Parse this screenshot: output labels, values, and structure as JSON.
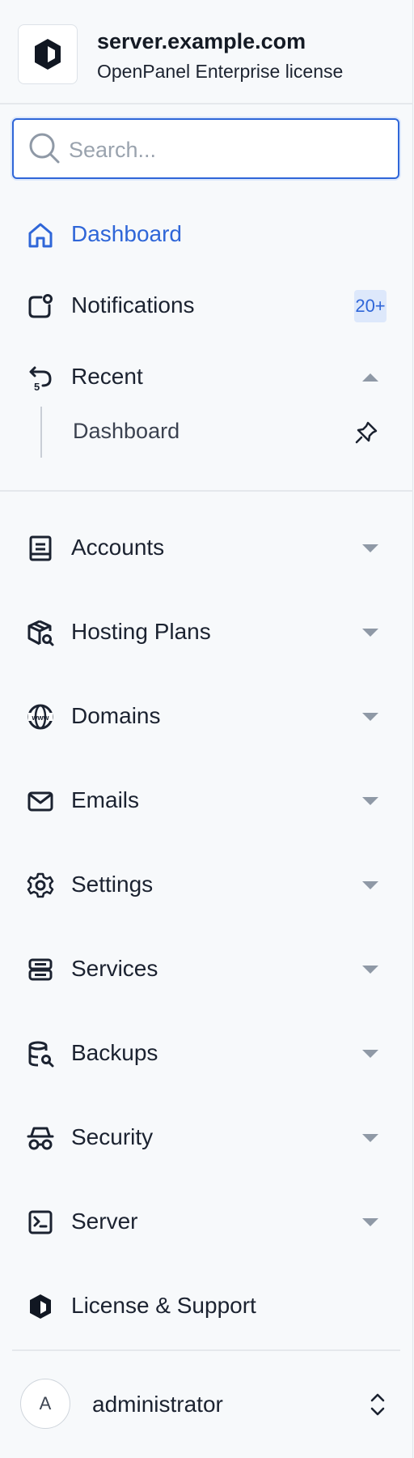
{
  "brand": {
    "title": "server.example.com",
    "subtitle": "OpenPanel Enterprise license",
    "icon": "openpanel-logo-icon"
  },
  "search": {
    "placeholder": "Search...",
    "value": "",
    "icon": "search-icon"
  },
  "nav_top": {
    "dashboard": {
      "label": "Dashboard",
      "icon": "home-icon",
      "active": true
    },
    "notifications": {
      "label": "Notifications",
      "badge": "20+",
      "icon": "notification-icon"
    },
    "recent": {
      "label": "Recent",
      "icon": "history-icon",
      "expanded": true,
      "items": [
        {
          "label": "Dashboard",
          "icon": "pin-icon"
        }
      ]
    }
  },
  "nav_sections": [
    {
      "label": "Accounts",
      "icon": "notebook-icon",
      "expanded": false
    },
    {
      "label": "Hosting Plans",
      "icon": "package-search-icon",
      "expanded": false
    },
    {
      "label": "Domains",
      "icon": "www-icon",
      "expanded": false
    },
    {
      "label": "Emails",
      "icon": "mail-icon",
      "expanded": false
    },
    {
      "label": "Settings",
      "icon": "gear-icon",
      "expanded": false
    },
    {
      "label": "Services",
      "icon": "server-stack-icon",
      "expanded": false
    },
    {
      "label": "Backups",
      "icon": "database-search-icon",
      "expanded": false
    },
    {
      "label": "Security",
      "icon": "incognito-icon",
      "expanded": false
    },
    {
      "label": "Server",
      "icon": "terminal-icon",
      "expanded": false
    }
  ],
  "license_support": {
    "label": "License & Support",
    "icon": "openpanel-hexagon-icon"
  },
  "profile": {
    "avatar_initial": "A",
    "name": "administrator",
    "icon": "chevron-up-down-icon"
  },
  "colors": {
    "accent": "#2f66d8",
    "badge_background": "#dde8fb",
    "sidebar_background": "#f7f9fb",
    "text": "#1b2230",
    "muted_chevron": "#8f99a6"
  }
}
